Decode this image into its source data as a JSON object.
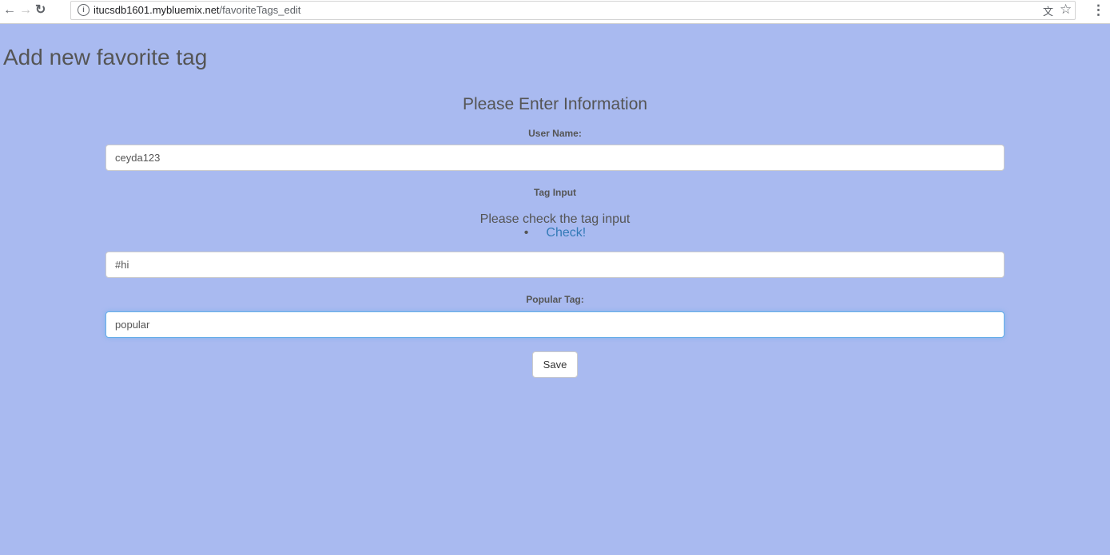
{
  "browser": {
    "url_host": "itucsdb1601.mybluemix.net",
    "url_path": "/favoriteTags_edit"
  },
  "page": {
    "heading": "Add new favorite tag",
    "form_title": "Please Enter Information"
  },
  "form": {
    "username_label": "User Name:",
    "username_value": "ceyda123",
    "tag_label": "Tag Input",
    "tag_message": "Please check the tag input",
    "check_link": "Check!",
    "tag_value": "#hi",
    "popular_label": "Popular Tag:",
    "popular_value": "popular",
    "save_label": "Save"
  },
  "colors": {
    "background": "#a9baf0",
    "link": "#337ab7",
    "focus_border": "#66afe9"
  }
}
